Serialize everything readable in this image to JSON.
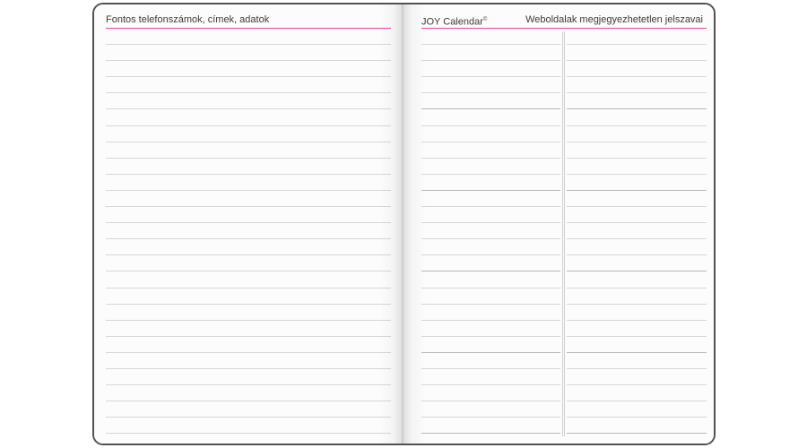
{
  "left_page": {
    "header": "Fontos telefonszámok, címek, adatok"
  },
  "right_page": {
    "brand": "JOY Calendar",
    "brand_mark": "©",
    "header": "Weboldalak megjegyezhetetlen jelszavai"
  },
  "colors": {
    "accent_line": "#e8449a",
    "cover_border": "#55504f",
    "rule": "#d7d7d7"
  }
}
